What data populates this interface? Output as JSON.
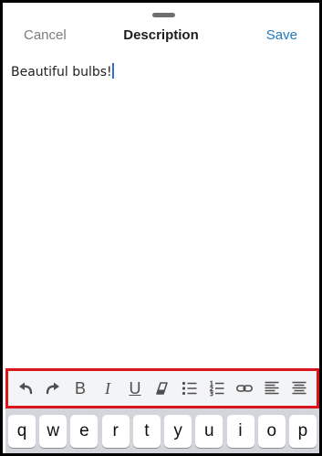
{
  "header": {
    "cancel_label": "Cancel",
    "title": "Description",
    "save_label": "Save"
  },
  "editor": {
    "text": "Beautiful bulbs!"
  },
  "toolbar": {
    "buttons": [
      {
        "name": "undo-icon",
        "glyph": ""
      },
      {
        "name": "redo-icon",
        "glyph": ""
      },
      {
        "name": "bold-icon",
        "glyph": "B"
      },
      {
        "name": "italic-icon",
        "glyph": "I"
      },
      {
        "name": "underline-icon",
        "glyph": "U"
      },
      {
        "name": "eraser-icon",
        "glyph": ""
      },
      {
        "name": "bullet-list-icon",
        "glyph": ""
      },
      {
        "name": "numbered-list-icon",
        "glyph": ""
      },
      {
        "name": "link-icon",
        "glyph": ""
      },
      {
        "name": "align-left-icon",
        "glyph": ""
      },
      {
        "name": "align-justify-icon",
        "glyph": ""
      }
    ],
    "highlight_color": "#d9141a"
  },
  "keyboard": {
    "row1": [
      "q",
      "w",
      "e",
      "r",
      "t",
      "y",
      "u",
      "i",
      "o",
      "p"
    ]
  },
  "colors": {
    "accent": "#1f7bbf",
    "caret": "#2f6fd6"
  }
}
